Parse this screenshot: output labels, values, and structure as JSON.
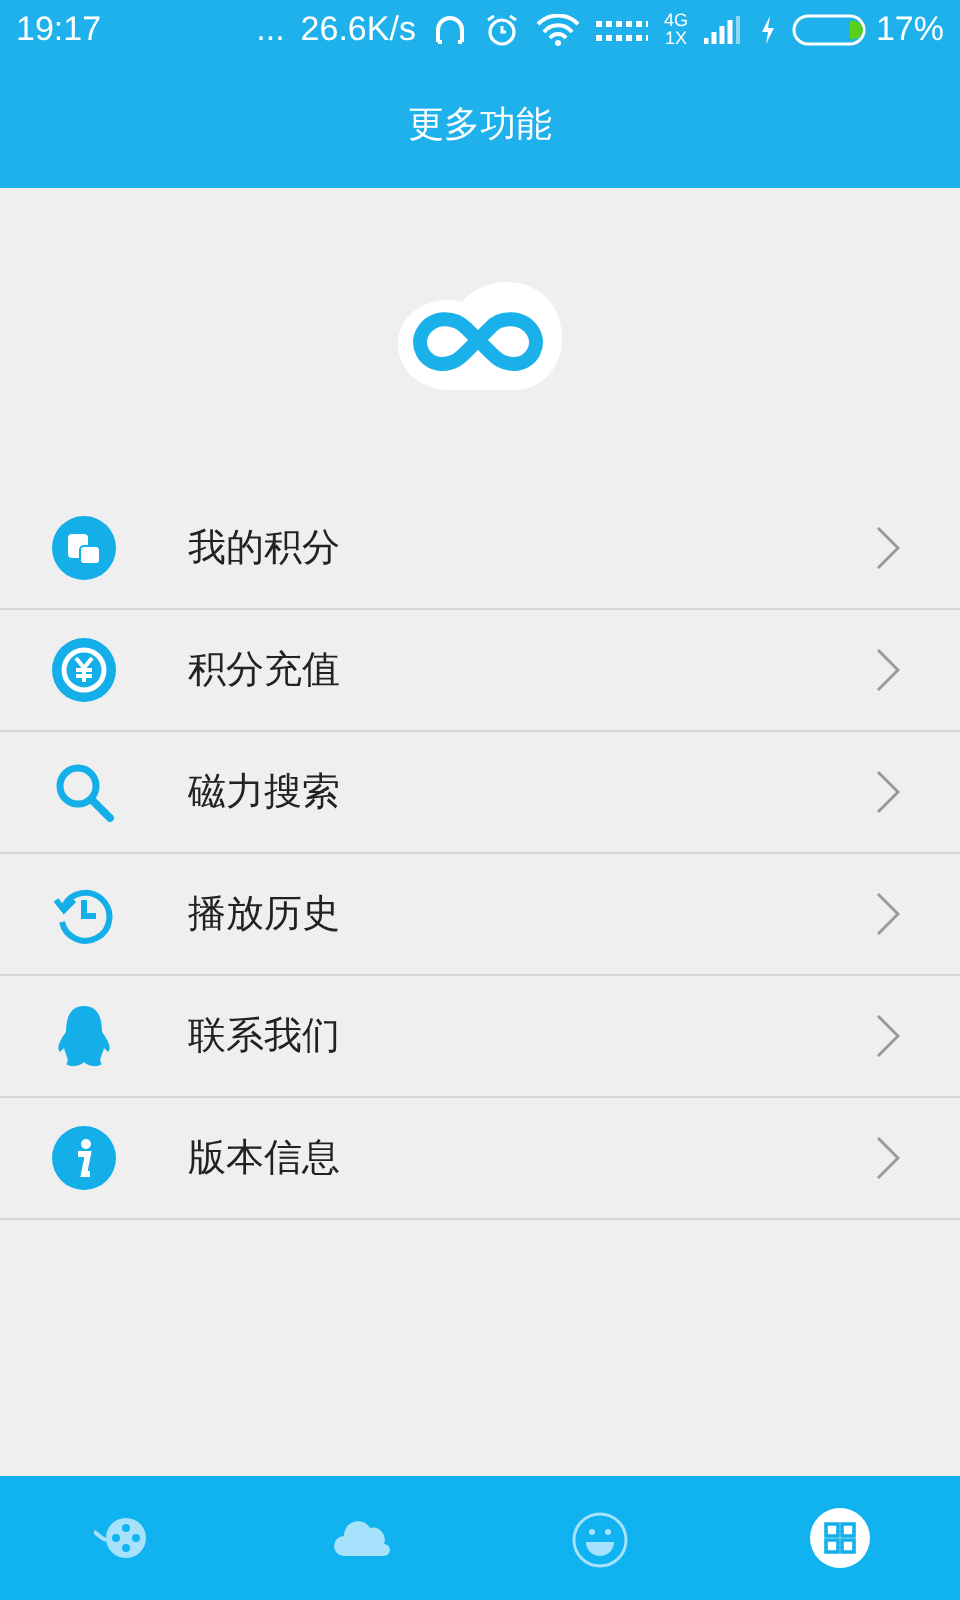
{
  "status_bar": {
    "time": "19:17",
    "dots": "...",
    "speed": "26.6K/s",
    "network": "4G",
    "network_sub": "1X",
    "battery": "17%"
  },
  "header": {
    "title": "更多功能"
  },
  "menu": [
    {
      "kind": "points",
      "label": "我的积分"
    },
    {
      "kind": "recharge",
      "label": "积分充值"
    },
    {
      "kind": "search",
      "label": "磁力搜索"
    },
    {
      "kind": "history",
      "label": "播放历史"
    },
    {
      "kind": "contact",
      "label": "联系我们"
    },
    {
      "kind": "info",
      "label": "版本信息"
    }
  ],
  "tabs": [
    {
      "kind": "video",
      "selected": false
    },
    {
      "kind": "cloud",
      "selected": false
    },
    {
      "kind": "smile",
      "selected": false
    },
    {
      "kind": "grid",
      "selected": true
    }
  ]
}
